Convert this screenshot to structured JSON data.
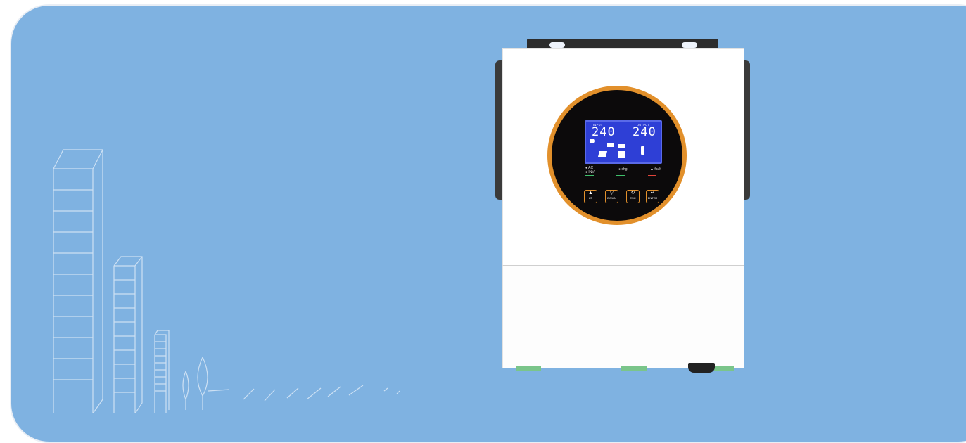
{
  "device": {
    "lcd": {
      "input_label": "INPUT",
      "output_label": "OUTPUT",
      "input_value": "240",
      "output_value": "240"
    },
    "leds": {
      "ac_label": "AC",
      "inv_label": "INV",
      "chg_label": "chg",
      "fault_label": "fault"
    },
    "buttons": [
      {
        "symbol": "▲",
        "label": "UP"
      },
      {
        "symbol": "▽",
        "label": "DOWN"
      },
      {
        "symbol": "↻",
        "label": "ESC"
      },
      {
        "symbol": "↵",
        "label": "ENTER"
      }
    ]
  },
  "colors": {
    "background": "#7fb2e1",
    "ring": "#e2902b",
    "lcd": "#2e3fd6",
    "led_ok": "#3fbf6a",
    "led_fault": "#e0443a"
  }
}
